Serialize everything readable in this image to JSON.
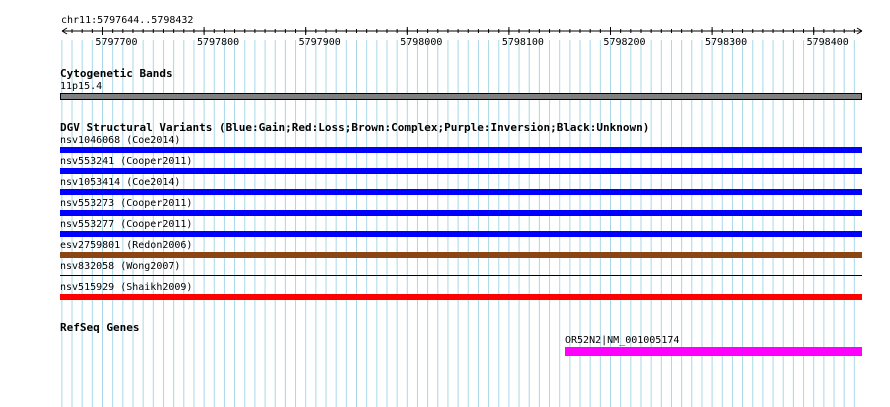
{
  "ruler": {
    "locus": "chr11:5797644..5798432",
    "tick_labels": [
      "5797700",
      "5797800",
      "5797900",
      "5798000",
      "5798100",
      "5798200",
      "5798300",
      "5798400"
    ]
  },
  "cytoband": {
    "title": "Cytogenetic Bands",
    "band_label": "11p15.4",
    "color": "#808080"
  },
  "dgv": {
    "title": "DGV Structural Variants (Blue:Gain;Red:Loss;Brown:Complex;Purple:Inversion;Black:Unknown)",
    "variants": [
      {
        "label": "nsv1046068 (Coe2014)",
        "type": "Gain",
        "color": "#0000ff"
      },
      {
        "label": "nsv553241 (Cooper2011)",
        "type": "Gain",
        "color": "#0000ff"
      },
      {
        "label": "nsv1053414 (Coe2014)",
        "type": "Gain",
        "color": "#0000ff"
      },
      {
        "label": "nsv553273 (Cooper2011)",
        "type": "Gain",
        "color": "#0000ff"
      },
      {
        "label": "nsv553277 (Cooper2011)",
        "type": "Gain",
        "color": "#0000ff"
      },
      {
        "label": "esv2759801 (Redon2006)",
        "type": "Complex",
        "color": "#8b4513"
      },
      {
        "label": "nsv832058 (Wong2007)",
        "type": "Unknown",
        "color": "#000000"
      },
      {
        "label": "nsv515929 (Shaikh2009)",
        "type": "Loss",
        "color": "#ff0000"
      }
    ]
  },
  "refseq": {
    "title": "RefSeq Genes",
    "gene_label": "OR52N2|NM_001005174",
    "color": "#ff00ff"
  }
}
